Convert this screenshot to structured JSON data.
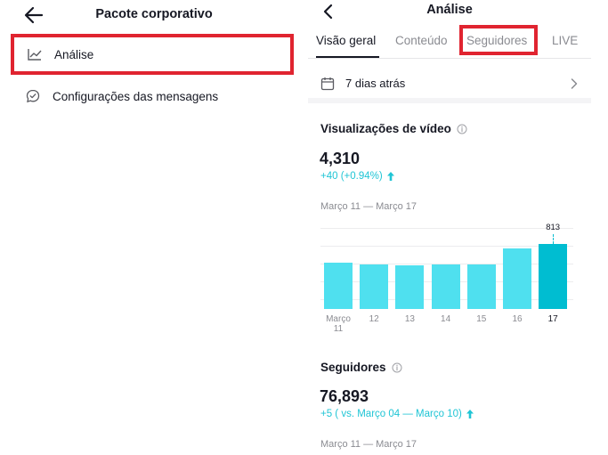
{
  "left": {
    "title": "Pacote corporativo",
    "items": [
      {
        "label": "Análise",
        "icon": "line-chart-icon"
      },
      {
        "label": "Configurações das mensagens",
        "icon": "message-settings-icon"
      }
    ]
  },
  "right": {
    "title": "Análise",
    "tabs": [
      {
        "label": "Visão geral",
        "active": true
      },
      {
        "label": "Conteúdo",
        "active": false
      },
      {
        "label": "Seguidores",
        "active": false
      },
      {
        "label": "LIVE",
        "active": false
      }
    ],
    "date_filter": "7 dias atrás",
    "video_views": {
      "title": "Visualizações de vídeo",
      "value": "4,310",
      "delta": "+40 (+0.94%)",
      "range": "Março 11 — Março 17"
    },
    "followers": {
      "title": "Seguidores",
      "value": "76,893",
      "delta": "+5 ( vs. Março 04 — Março 10)",
      "range": "Março 11 — Março 17"
    }
  },
  "chart_data": {
    "type": "bar",
    "categories": [
      "Março 11",
      "12",
      "13",
      "14",
      "15",
      "16",
      "17"
    ],
    "values": [
      575,
      550,
      545,
      555,
      560,
      755,
      813
    ],
    "highlight_label": "813",
    "highlight_index": 6,
    "ylim": [
      0,
      1000
    ],
    "grid": true
  },
  "colors": {
    "accent": "#20c5d5",
    "bar": "#4fe0ef",
    "bar_highlight": "#00bdd1",
    "annotation_box": "#e02430"
  }
}
